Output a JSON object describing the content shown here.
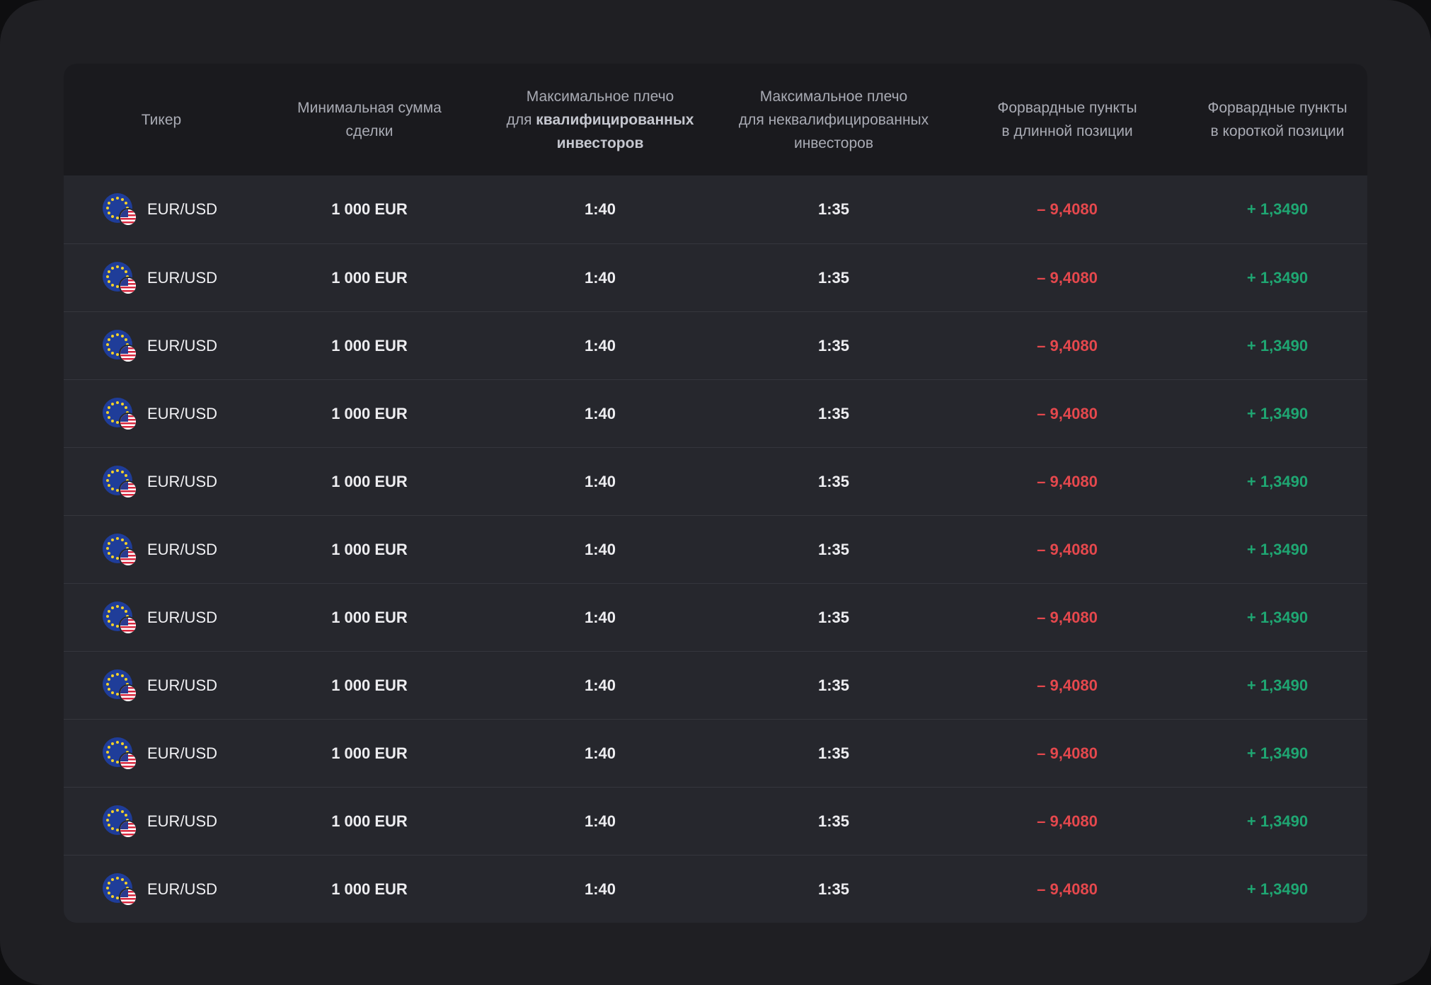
{
  "columns": {
    "ticker": "Тикер",
    "min_amount_l1": "Минимальная сумма",
    "min_amount_l2": "сделки",
    "lev_q_l1": "Максимальное плечо",
    "lev_q_l2a": "для ",
    "lev_q_l2b": "квалифицированных",
    "lev_q_l3": "инвесторов",
    "lev_nq_l1": "Максимальное плечо",
    "lev_nq_l2": "для неквалифицированных",
    "lev_nq_l3": "инвесторов",
    "fwd_long_l1": "Форвардные пункты",
    "fwd_long_l2": "в длинной позиции",
    "fwd_short_l1": "Форвардные пункты",
    "fwd_short_l2": "в короткой позиции"
  },
  "colors": {
    "negative": "#e5484d",
    "positive": "#1fa672",
    "background": "#1f1f23",
    "header": "#1a1a1e",
    "row": "#26272d"
  },
  "rows": [
    {
      "icon": "eu-us-flag-icon",
      "ticker": "EUR/USD",
      "min_amount": "1 000 EUR",
      "lev_qualified": "1:40",
      "lev_non_qualified": "1:35",
      "fwd_long": "– 9,4080",
      "fwd_short": "+ 1,3490"
    },
    {
      "icon": "eu-us-flag-icon",
      "ticker": "EUR/USD",
      "min_amount": "1 000 EUR",
      "lev_qualified": "1:40",
      "lev_non_qualified": "1:35",
      "fwd_long": "– 9,4080",
      "fwd_short": "+ 1,3490"
    },
    {
      "icon": "eu-us-flag-icon",
      "ticker": "EUR/USD",
      "min_amount": "1 000 EUR",
      "lev_qualified": "1:40",
      "lev_non_qualified": "1:35",
      "fwd_long": "– 9,4080",
      "fwd_short": "+ 1,3490"
    },
    {
      "icon": "eu-us-flag-icon",
      "ticker": "EUR/USD",
      "min_amount": "1 000 EUR",
      "lev_qualified": "1:40",
      "lev_non_qualified": "1:35",
      "fwd_long": "– 9,4080",
      "fwd_short": "+ 1,3490"
    },
    {
      "icon": "eu-us-flag-icon",
      "ticker": "EUR/USD",
      "min_amount": "1 000 EUR",
      "lev_qualified": "1:40",
      "lev_non_qualified": "1:35",
      "fwd_long": "– 9,4080",
      "fwd_short": "+ 1,3490"
    },
    {
      "icon": "eu-us-flag-icon",
      "ticker": "EUR/USD",
      "min_amount": "1 000 EUR",
      "lev_qualified": "1:40",
      "lev_non_qualified": "1:35",
      "fwd_long": "– 9,4080",
      "fwd_short": "+ 1,3490"
    },
    {
      "icon": "eu-us-flag-icon",
      "ticker": "EUR/USD",
      "min_amount": "1 000 EUR",
      "lev_qualified": "1:40",
      "lev_non_qualified": "1:35",
      "fwd_long": "– 9,4080",
      "fwd_short": "+ 1,3490"
    },
    {
      "icon": "eu-us-flag-icon",
      "ticker": "EUR/USD",
      "min_amount": "1 000 EUR",
      "lev_qualified": "1:40",
      "lev_non_qualified": "1:35",
      "fwd_long": "– 9,4080",
      "fwd_short": "+ 1,3490"
    },
    {
      "icon": "eu-us-flag-icon",
      "ticker": "EUR/USD",
      "min_amount": "1 000 EUR",
      "lev_qualified": "1:40",
      "lev_non_qualified": "1:35",
      "fwd_long": "– 9,4080",
      "fwd_short": "+ 1,3490"
    },
    {
      "icon": "eu-us-flag-icon",
      "ticker": "EUR/USD",
      "min_amount": "1 000 EUR",
      "lev_qualified": "1:40",
      "lev_non_qualified": "1:35",
      "fwd_long": "– 9,4080",
      "fwd_short": "+ 1,3490"
    },
    {
      "icon": "eu-us-flag-icon",
      "ticker": "EUR/USD",
      "min_amount": "1 000 EUR",
      "lev_qualified": "1:40",
      "lev_non_qualified": "1:35",
      "fwd_long": "– 9,4080",
      "fwd_short": "+ 1,3490"
    }
  ]
}
